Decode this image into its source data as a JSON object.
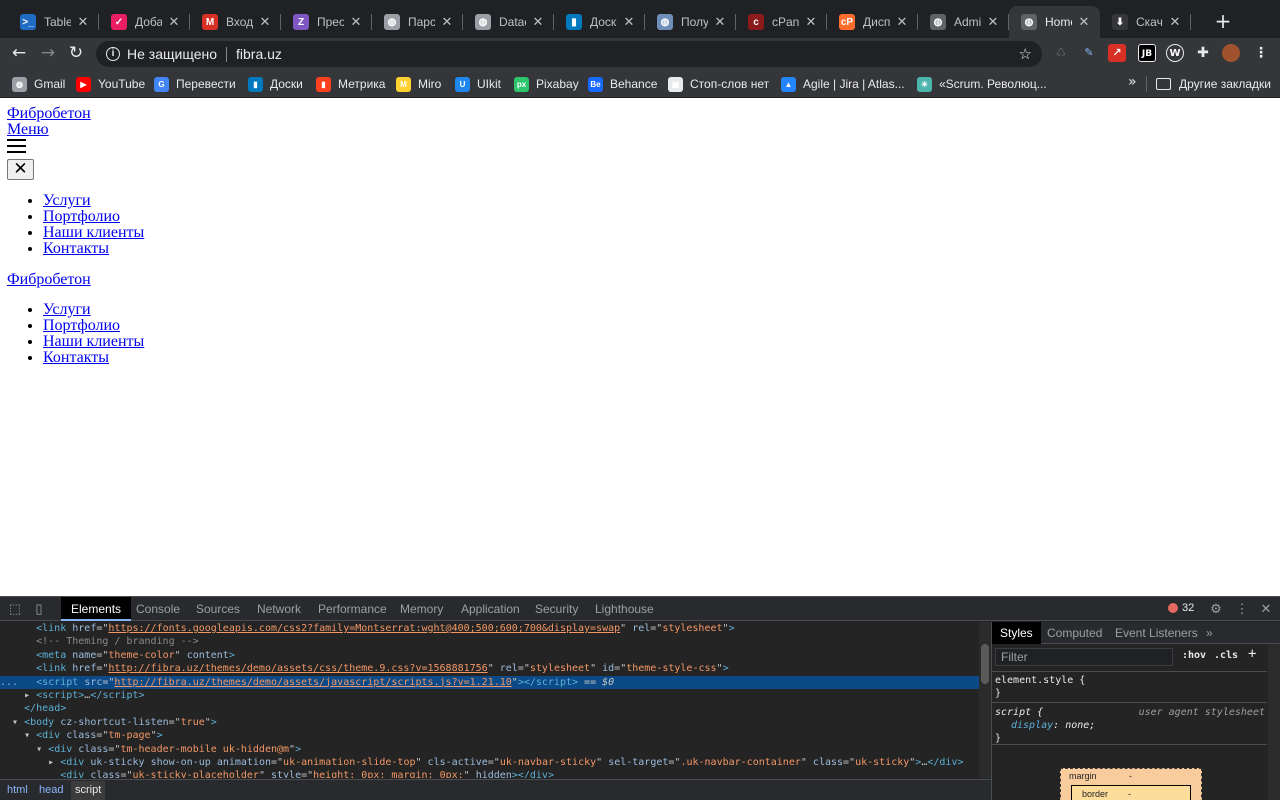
{
  "tabs": [
    {
      "title": "Tabler",
      "favicon": "tabler-icon",
      "color": "#206bc4",
      "glyph": ">_"
    },
    {
      "title": "Добавь",
      "favicon": "check-heart-icon",
      "color": "#e91e63",
      "glyph": "✓"
    },
    {
      "title": "Входящ",
      "favicon": "gmail-icon",
      "color": "#d93025",
      "glyph": "M"
    },
    {
      "title": "Преобр",
      "favicon": "converter-icon",
      "color": "#7e57c2",
      "glyph": "Z"
    },
    {
      "title": "Парсер",
      "favicon": "globe-icon",
      "color": "#9aa0a6",
      "glyph": "◍"
    },
    {
      "title": "Datacol",
      "favicon": "globe-icon",
      "color": "#9aa0a6",
      "glyph": "◍"
    },
    {
      "title": "Доски",
      "favicon": "trello-icon",
      "color": "#0079bf",
      "glyph": "▮"
    },
    {
      "title": "Получ",
      "favicon": "planet-icon",
      "color": "#6f8fb8",
      "glyph": "◍"
    },
    {
      "title": "cPanel",
      "favicon": "cpanel-icon",
      "color": "#8b1a1a",
      "glyph": "c"
    },
    {
      "title": "Диспе",
      "favicon": "cp-orange-icon",
      "color": "#ff6c2c",
      "glyph": "cP"
    },
    {
      "title": "Admin",
      "favicon": "globe-icon",
      "color": "#5f6368",
      "glyph": "◍"
    },
    {
      "title": "Home",
      "favicon": "globe-icon",
      "color": "#5f6368",
      "glyph": "◍",
      "active": true
    },
    {
      "title": "Скачан",
      "favicon": "download-icon",
      "color": "#35363a",
      "glyph": "⬇"
    }
  ],
  "omnibox": {
    "security_label": "Не защищено",
    "url": "fibra.uz"
  },
  "bookmarks": [
    {
      "label": "Gmail",
      "icon": "globe-icon",
      "color": "#9aa0a6",
      "glyph": "◍"
    },
    {
      "label": "YouTube",
      "icon": "youtube-icon",
      "color": "#ff0000",
      "glyph": "▶"
    },
    {
      "label": "Перевести",
      "icon": "google-translate-icon",
      "color": "#4285f4",
      "glyph": "G"
    },
    {
      "label": "Доски",
      "icon": "trello-icon",
      "color": "#0079bf",
      "glyph": "▮"
    },
    {
      "label": "Метрика",
      "icon": "metrika-icon",
      "color": "#fc3f1d",
      "glyph": "▮"
    },
    {
      "label": "Miro",
      "icon": "miro-icon",
      "color": "#ffd02f",
      "glyph": "M"
    },
    {
      "label": "UIkit",
      "icon": "uikit-icon",
      "color": "#1e87f0",
      "glyph": "U"
    },
    {
      "label": "Pixabay",
      "icon": "pixabay-icon",
      "color": "#2ec66d",
      "glyph": "px"
    },
    {
      "label": "Behance",
      "icon": "behance-icon",
      "color": "#1769ff",
      "glyph": "Be"
    },
    {
      "label": "Стоп-слов нет",
      "icon": "stopwords-icon",
      "color": "#e8eaed",
      "glyph": "▦"
    },
    {
      "label": "Agile | Jira | Atlas...",
      "icon": "atlassian-icon",
      "color": "#2684ff",
      "glyph": "▲"
    },
    {
      "label": "«Scrum. Революц...",
      "icon": "scrum-icon",
      "color": "#4db6ac",
      "glyph": "✳"
    }
  ],
  "other_bookmarks": "Другие закладки",
  "page": {
    "brand": "Фибробетон",
    "menu": "Меню",
    "nav": [
      "Услуги",
      "Портфолио",
      "Наши клиенты",
      "Контакты"
    ]
  },
  "devtools": {
    "tabs": [
      "Elements",
      "Console",
      "Sources",
      "Network",
      "Performance",
      "Memory",
      "Application",
      "Security",
      "Lighthouse"
    ],
    "active_tab": "Elements",
    "error_count": "32",
    "breadcrumbs": [
      "html",
      "head",
      "script"
    ],
    "styles_tabs": [
      "Styles",
      "Computed",
      "Event Listeners"
    ],
    "filter_placeholder": "Filter",
    "hov": ":hov",
    "cls": ".cls",
    "element_style": "element.style {",
    "close_brace": "}",
    "rule_selector": "script {",
    "rule_source": "user agent stylesheet",
    "rule_prop": "display",
    "rule_value": "none;",
    "box_margin": "margin",
    "box_border": "border",
    "box_dash": "-"
  }
}
